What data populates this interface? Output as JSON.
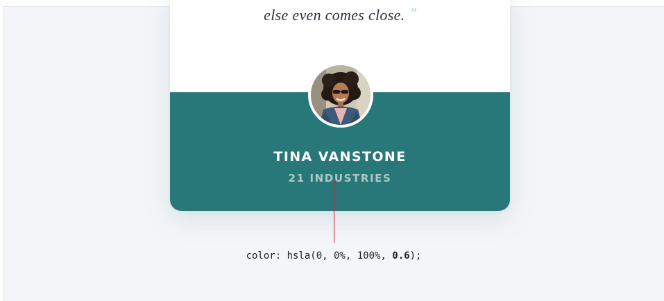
{
  "testimonial": {
    "quote_fragment": "else even comes close.",
    "quote_mark": "”",
    "author_name": "TINA VANSTONE",
    "author_company": "21 INDUSTRIES"
  },
  "annotation": {
    "prefix": "color: hsla(0, 0%, 100%, ",
    "emphasis": "0.6",
    "suffix": ");"
  },
  "colors": {
    "card_bottom": "#28787a",
    "card_top": "#ffffff",
    "page_bg": "#f4f5f9",
    "pointer": "#e0152d",
    "quote_mark": "#b9dcd8"
  }
}
